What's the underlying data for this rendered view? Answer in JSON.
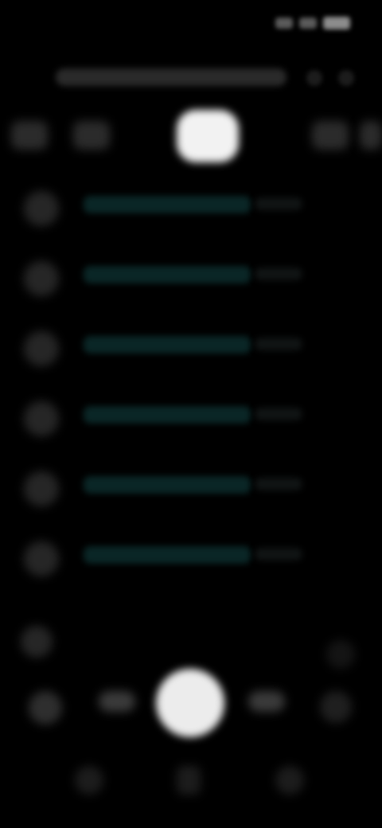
{
  "status_bar": {
    "time": "",
    "icons": [
      "signal-icon",
      "wifi-icon",
      "battery-icon"
    ]
  },
  "search": {
    "placeholder": "",
    "side_icons": [
      "mic-icon",
      "more-icon"
    ]
  },
  "top_tabs": [
    {
      "icon": "tab-icon-1",
      "active": false
    },
    {
      "icon": "tab-icon-2",
      "active": false
    },
    {
      "icon": "tab-icon-active",
      "active": true
    },
    {
      "icon": "tab-icon-4",
      "active": false
    },
    {
      "icon": "tab-icon-5",
      "active": false
    }
  ],
  "list": {
    "items": [
      {
        "icon": "list-item-icon",
        "label": "",
        "meta": ""
      },
      {
        "icon": "list-item-icon",
        "label": "",
        "meta": ""
      },
      {
        "icon": "list-item-icon",
        "label": "",
        "meta": ""
      },
      {
        "icon": "list-item-icon",
        "label": "",
        "meta": ""
      },
      {
        "icon": "list-item-icon",
        "label": "",
        "meta": ""
      },
      {
        "icon": "list-item-icon",
        "label": "",
        "meta": ""
      }
    ]
  },
  "bottom": {
    "controls": [
      "control-icon-1",
      "control-icon-2",
      "main-action-icon",
      "control-icon-4",
      "control-icon-5"
    ],
    "nav": [
      "back-icon",
      "home-icon",
      "recents-icon"
    ]
  },
  "colors": {
    "background": "#000000",
    "active_tab": "#f2f2f2",
    "list_label": "#0a2626",
    "main_action": "#ececec"
  }
}
